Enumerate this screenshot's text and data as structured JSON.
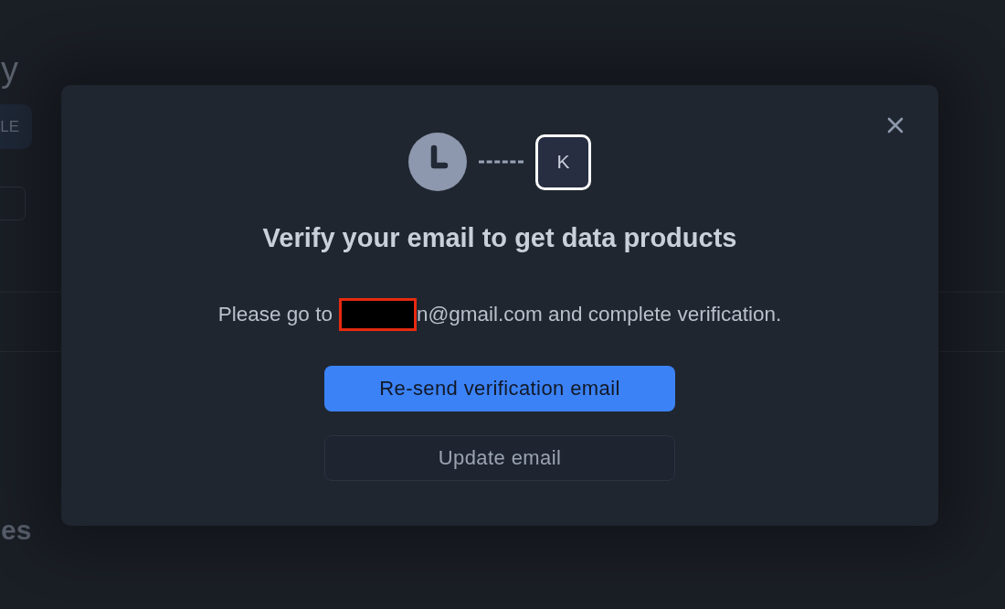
{
  "background": {
    "heading": "y",
    "button": "LE",
    "section_heading": "es"
  },
  "dialog": {
    "avatar_letter": "K",
    "title": "Verify your email to get data products",
    "message": {
      "before": "Please go to",
      "after": "n@gmail.com and complete verification."
    },
    "buttons": [
      {
        "label": "Re-send verification email",
        "kind": "primary"
      },
      {
        "label": "Update email",
        "kind": "secondary"
      }
    ]
  }
}
